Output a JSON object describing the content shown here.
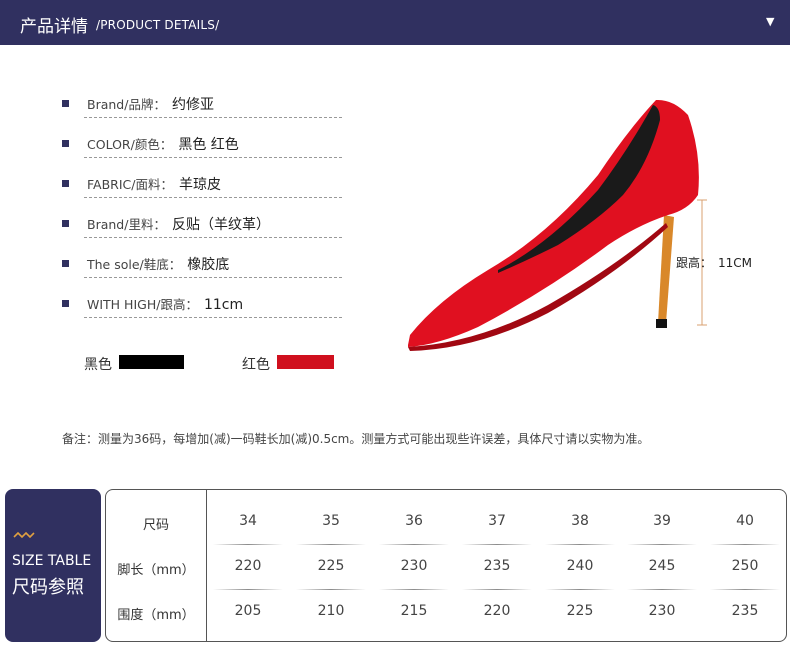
{
  "header": {
    "title": "产品详情",
    "subtitle": "/PRODUCT DETAILS/"
  },
  "specs": [
    {
      "label": "Brand/品牌：",
      "value": "约修亚"
    },
    {
      "label": "COLOR/颜色：",
      "value": "黑色 红色"
    },
    {
      "label": " FABRIC/面料：",
      "value": "羊琼皮"
    },
    {
      "label": "Brand/里料：",
      "value": "反贴（羊纹革）"
    },
    {
      "label": "The sole/鞋底：",
      "value": "橡胶底"
    },
    {
      "label": "WITH HIGH/跟高：",
      "value": "11cm"
    }
  ],
  "colors": [
    {
      "label": "黑色",
      "hex": "#000000"
    },
    {
      "label": "红色",
      "hex": "#d0101e"
    }
  ],
  "product_image": {
    "height_label": "跟高：",
    "height_value": "11CM"
  },
  "note": "备注：测量为36码，每增加(减)一码鞋长加(减)0.5cm。测量方式可能出现些许误差，具体尺寸请以实物为准。",
  "size_table": {
    "badge_en": "SIZE TABLE",
    "badge_zh": "尺码参照",
    "rows": [
      {
        "header": "尺码",
        "values": [
          "34",
          "35",
          "36",
          "37",
          "38",
          "39",
          "40"
        ]
      },
      {
        "header": "脚长（mm）",
        "values": [
          "220",
          "225",
          "230",
          "235",
          "240",
          "245",
          "250"
        ]
      },
      {
        "header": "围度（mm）",
        "values": [
          "205",
          "210",
          "215",
          "220",
          "225",
          "230",
          "235"
        ]
      }
    ]
  },
  "theme": {
    "navy": "#303060",
    "shoe_red": "#e01020",
    "heel_orange": "#d9882a"
  }
}
